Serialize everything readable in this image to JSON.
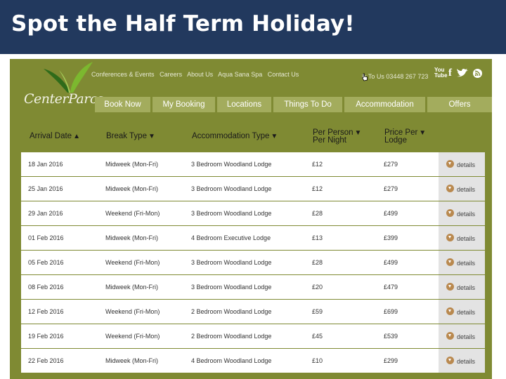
{
  "slide": {
    "title": "Spot the Half Term Holiday!"
  },
  "site": {
    "logo_text": "CenterParcs",
    "top_links": [
      "Conferences & Events",
      "Careers",
      "About Us",
      "Aqua Sana Spa",
      "Contact Us"
    ],
    "phone": "lk To Us 03448 267 723",
    "socials": [
      "youtube-icon",
      "facebook-icon",
      "twitter-icon",
      "rss-icon"
    ],
    "nav": [
      "Book Now",
      "My Booking",
      "Locations",
      "Things To Do",
      "Accommodation",
      "Offers"
    ]
  },
  "table": {
    "columns": [
      {
        "label": "Arrival Date",
        "arrow": "▲"
      },
      {
        "label": "Break Type",
        "arrow": "▼"
      },
      {
        "label": "Accommodation Type",
        "arrow": "▼"
      },
      {
        "label": "Per Person Per Night",
        "line1": "Per Person",
        "line2": "Per Night",
        "arrow": "▼"
      },
      {
        "label": "Price Per Lodge",
        "line1": "Price Per",
        "line2": "Lodge",
        "arrow": "▼"
      }
    ],
    "rows": [
      {
        "date": "18 Jan 2016",
        "break": "Midweek (Mon-Fri)",
        "accommodation": "3 Bedroom Woodland Lodge",
        "per_person": "£12",
        "price": "£279",
        "details": "details"
      },
      {
        "date": "25 Jan 2016",
        "break": "Midweek (Mon-Fri)",
        "accommodation": "3 Bedroom Woodland Lodge",
        "per_person": "£12",
        "price": "£279",
        "details": "details"
      },
      {
        "date": "29 Jan 2016",
        "break": "Weekend (Fri-Mon)",
        "accommodation": "3 Bedroom Woodland Lodge",
        "per_person": "£28",
        "price": "£499",
        "details": "details"
      },
      {
        "date": "01 Feb 2016",
        "break": "Midweek (Mon-Fri)",
        "accommodation": "4 Bedroom Executive Lodge",
        "per_person": "£13",
        "price": "£399",
        "details": "details"
      },
      {
        "date": "05 Feb 2016",
        "break": "Weekend (Fri-Mon)",
        "accommodation": "3 Bedroom Woodland Lodge",
        "per_person": "£28",
        "price": "£499",
        "details": "details"
      },
      {
        "date": "08 Feb 2016",
        "break": "Midweek (Mon-Fri)",
        "accommodation": "3 Bedroom Woodland Lodge",
        "per_person": "£20",
        "price": "£479",
        "details": "details"
      },
      {
        "date": "12 Feb 2016",
        "break": "Weekend (Fri-Mon)",
        "accommodation": "2 Bedroom Woodland Lodge",
        "per_person": "£59",
        "price": "£699",
        "details": "details"
      },
      {
        "date": "19 Feb 2016",
        "break": "Weekend (Fri-Mon)",
        "accommodation": "2 Bedroom Woodland Lodge",
        "per_person": "£45",
        "price": "£539",
        "details": "details"
      },
      {
        "date": "22 Feb 2016",
        "break": "Midweek (Mon-Fri)",
        "accommodation": "4 Bedroom Woodland Lodge",
        "per_person": "£10",
        "price": "£299",
        "details": "details"
      }
    ]
  },
  "colors": {
    "slide_header": "#22395e",
    "site_green": "#7f8a33",
    "nav_tab": "#a3ac5d",
    "details_bg": "#e3e3e3",
    "details_icon": "#b9894f"
  }
}
